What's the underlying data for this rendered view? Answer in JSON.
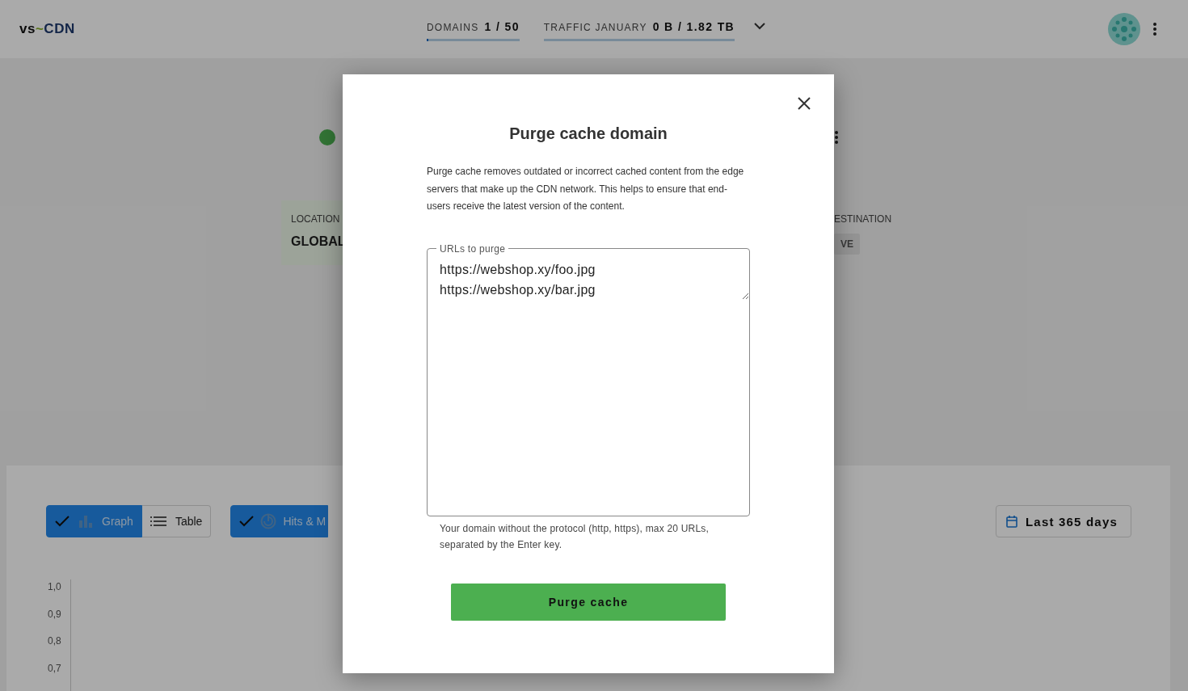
{
  "header": {
    "logo": {
      "prefix": "vs",
      "tilde": "~",
      "name": "CDN"
    },
    "meters": [
      {
        "label": "DOMAINS",
        "value": "1 / 50",
        "level": 0.02
      },
      {
        "label": "TRAFFIC JANUARY",
        "value": "0 B / 1.82 TB",
        "level": 0
      }
    ]
  },
  "domain": {
    "active": true,
    "location_label": "LOCATION",
    "location_value": "GLOBAL",
    "destination_label": "ESTINATION",
    "destination_value": "VE"
  },
  "stats": {
    "view_toggle": [
      {
        "label": "Graph",
        "kind": "graph",
        "selected": true
      },
      {
        "label": "Table",
        "kind": "table",
        "selected": false
      }
    ],
    "metric_toggle": {
      "label": "Hits & M",
      "selected": true
    },
    "date_range": "Last 365 days",
    "y_axis": [
      "1,0",
      "0,9",
      "0,8",
      "0,7"
    ]
  },
  "modal": {
    "title": "Purge cache domain",
    "description": "Purge cache removes outdated or incorrect cached content from the edge servers that make up the CDN network. This helps to ensure that end-users receive the latest version of the content.",
    "field_label": "URLs to purge",
    "urls": [
      "https://webshop.xy/foo.jpg",
      "https://webshop.xy/bar.jpg"
    ],
    "helper": "Your domain without the protocol (http, https), max 20 URLs, separated by the Enter key.",
    "submit": "Purge cache"
  }
}
